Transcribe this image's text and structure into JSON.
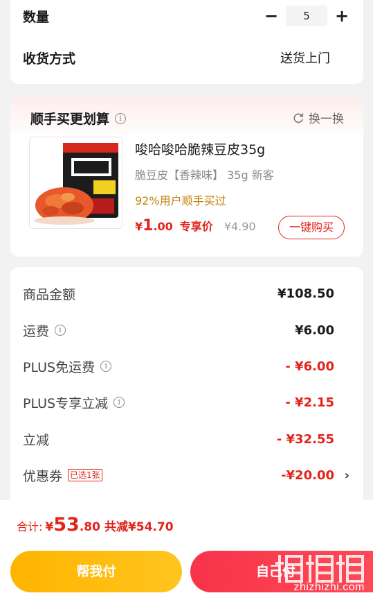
{
  "top": {
    "qty_label": "数量",
    "minus": "−",
    "qty_value": "5",
    "plus": "+",
    "delivery_label": "收货方式",
    "delivery_value": "送货上门"
  },
  "recommend": {
    "title": "顺手买更划算",
    "info": "i",
    "swap_label": "换一换",
    "product": {
      "name": "唆哈唆哈脆辣豆皮35g",
      "spec": "脆豆皮【香辣味】 35g 新客",
      "bought": "92%用户顺手买过",
      "price_yen": "¥",
      "price_int": "1",
      "price_dec": ".00",
      "price_tag": "专享价",
      "orig_price": "¥4.90",
      "buy_label": "一键购买"
    }
  },
  "summary": {
    "items": [
      {
        "label": "商品金额",
        "value": "¥108.50"
      },
      {
        "label": "运费",
        "value": "¥6.00"
      },
      {
        "label": "PLUS免运费",
        "value": "- ¥6.00"
      },
      {
        "label": "PLUS专享立减",
        "value": "- ¥2.15"
      },
      {
        "label": "立减",
        "value": "- ¥32.55"
      },
      {
        "label": "优惠券",
        "tag": "已选1张",
        "value": "-¥20.00",
        "chevron": "›"
      }
    ]
  },
  "bottom": {
    "total_label": "合计:",
    "total_yen": "¥",
    "total_int": "53",
    "total_dec": ".80",
    "saved": "共减¥54.70",
    "pay_friend": "帮我付",
    "pay_self": "自己付",
    "watermark": "zhizhizhi.com"
  },
  "colors": {
    "accent_red": "#e2231a",
    "gold": "#c2820b",
    "friend_btn": "#ffb400",
    "self_btn": "#f7334a"
  }
}
